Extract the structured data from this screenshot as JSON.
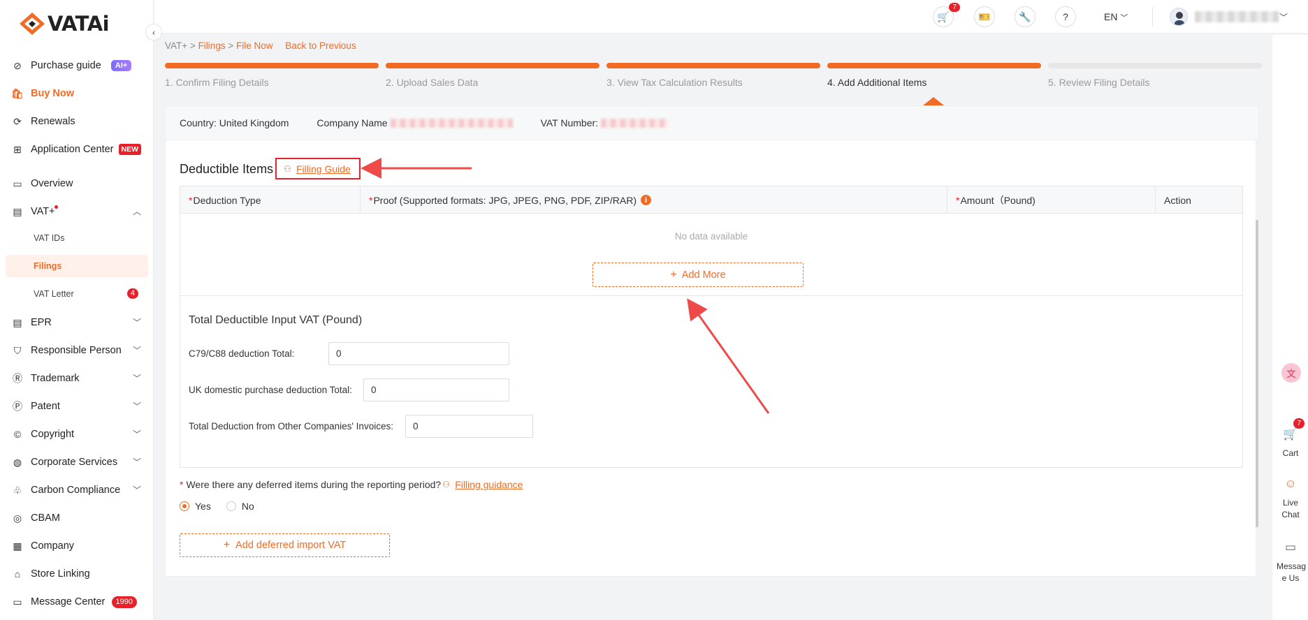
{
  "app": {
    "brand": "VATAi"
  },
  "sidebar": {
    "items": [
      {
        "label": "Purchase guide",
        "badge": "AI+",
        "icon": "compass-icon"
      },
      {
        "label": "Buy Now",
        "icon": "shopping-bag-icon"
      },
      {
        "label": "Renewals",
        "icon": "renew-icon"
      },
      {
        "label": "Application Center",
        "badge": "NEW",
        "icon": "apps-icon"
      },
      {
        "label": "Overview",
        "icon": "monitor-icon"
      },
      {
        "label": "VAT+",
        "icon": "vat-icon"
      },
      {
        "label": "EPR",
        "icon": "epr-icon"
      },
      {
        "label": "Responsible Person",
        "icon": "shield-check-icon"
      },
      {
        "label": "Trademark",
        "icon": "trademark-icon"
      },
      {
        "label": "Patent",
        "icon": "patent-icon"
      },
      {
        "label": "Copyright",
        "icon": "copyright-icon"
      },
      {
        "label": "Corporate Services",
        "icon": "globe-icon"
      },
      {
        "label": "Carbon Compliance",
        "icon": "leaf-icon"
      },
      {
        "label": "CBAM",
        "icon": "cbam-icon"
      },
      {
        "label": "Company",
        "icon": "building-icon"
      },
      {
        "label": "Store Linking",
        "icon": "store-icon"
      },
      {
        "label": "Message Center",
        "badge": "1990",
        "icon": "bell-icon"
      }
    ],
    "vat_sub": [
      {
        "label": "VAT IDs"
      },
      {
        "label": "Filings"
      },
      {
        "label": "VAT Letter",
        "badge": "4"
      }
    ]
  },
  "header": {
    "cart_count": "7",
    "lang": "EN"
  },
  "breadcrumb": {
    "root": "VAT+",
    "sep": ">",
    "filings": "Filings",
    "current": "File Now",
    "back": "Back to Previous"
  },
  "steps": [
    {
      "label": "1. Confirm Filing Details",
      "state": "done"
    },
    {
      "label": "2. Upload Sales Data",
      "state": "done"
    },
    {
      "label": "3. View Tax Calculation Results",
      "state": "done"
    },
    {
      "label": "4. Add Additional Items",
      "state": "current"
    },
    {
      "label": "5. Review Filing Details",
      "state": "todo"
    }
  ],
  "info": {
    "country": "Country: United Kingdom",
    "company_label": "Company Name",
    "vat_label": "VAT Number:"
  },
  "deductible": {
    "title": "Deductible Items",
    "guide": "Filling Guide",
    "columns": {
      "type": "Deduction Type",
      "proof": "Proof (Supported formats: JPG, JPEG, PNG, PDF, ZIP/RAR)",
      "amount": "Amount（Pound)",
      "action": "Action"
    },
    "required_mark": "*",
    "info_mark": "i",
    "empty": "No data available",
    "add_more": "Add More"
  },
  "totals": {
    "title": "Total Deductible Input VAT (Pound)",
    "fields": [
      {
        "label": "C79/C88 deduction Total:",
        "value": "0"
      },
      {
        "label": "UK domestic purchase deduction Total:",
        "value": "0"
      },
      {
        "label": "Total Deduction from Other Companies' Invoices:",
        "value": "0"
      }
    ]
  },
  "deferred": {
    "question": "Were there any deferred items during the reporting period?",
    "guide": "Filling guidance",
    "yes": "Yes",
    "no": "No",
    "selected": "Yes",
    "add_button": "Add deferred import VAT"
  },
  "rail": {
    "cart_label": "Cart",
    "cart_count": "7",
    "chat_label": "Live Chat",
    "message_label": "Messag e Us"
  },
  "colors": {
    "accent": "#f26b25",
    "danger": "#e8202a"
  }
}
